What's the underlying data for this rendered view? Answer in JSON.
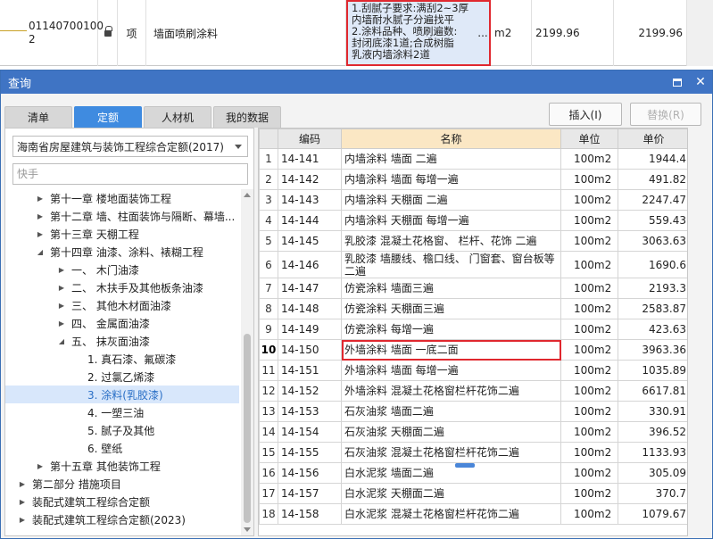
{
  "top_row": {
    "code_line1": "01140700100",
    "code_line2": "2",
    "unit": "项",
    "name": "墙面喷刷涂料",
    "description": "1.刮腻子要求:满刮2~3厚\n内墙耐水腻子分遍找平\n2.涂料品种、喷刷遍数:\n封闭底漆1道;合成树脂\n乳液内墙涂料2道",
    "dots": "...",
    "measure_unit": "m2",
    "price1": "2199.96",
    "price2": "2199.96"
  },
  "dialog": {
    "title": "查询",
    "tabs": [
      {
        "label": "清单"
      },
      {
        "label": "定额"
      },
      {
        "label": "人材机"
      },
      {
        "label": "我的数据"
      }
    ],
    "insert_label": "插入(I)",
    "replace_label": "替换(R)"
  },
  "left": {
    "select_value": "海南省房屋建筑与装饰工程综合定额(2017)",
    "search_placeholder": "快手",
    "tree": [
      {
        "label": "第十一章 楼地面装饰工程",
        "level": 1,
        "toggle": "▶",
        "selected": false
      },
      {
        "label": "第十二章 墙、柱面装饰与隔断、幕墙...",
        "level": 1,
        "toggle": "▶",
        "selected": false
      },
      {
        "label": "第十三章 天棚工程",
        "level": 1,
        "toggle": "▶",
        "selected": false
      },
      {
        "label": "第十四章 油漆、涂料、裱糊工程",
        "level": 1,
        "toggle": "◢",
        "selected": false
      },
      {
        "label": "一、 木门油漆",
        "level": 2,
        "toggle": "▶",
        "selected": false
      },
      {
        "label": "二、 木扶手及其他板条油漆",
        "level": 2,
        "toggle": "▶",
        "selected": false
      },
      {
        "label": "三、 其他木材面油漆",
        "level": 2,
        "toggle": "▶",
        "selected": false
      },
      {
        "label": "四、 金属面油漆",
        "level": 2,
        "toggle": "▶",
        "selected": false
      },
      {
        "label": "五、 抹灰面油漆",
        "level": 2,
        "toggle": "◢",
        "selected": false
      },
      {
        "label": "1. 真石漆、氟碳漆",
        "level": 3,
        "toggle": "",
        "selected": false
      },
      {
        "label": "2. 过氯乙烯漆",
        "level": 3,
        "toggle": "",
        "selected": false
      },
      {
        "label": "3. 涂料(乳胶漆)",
        "level": 3,
        "toggle": "",
        "selected": true
      },
      {
        "label": "4. 一塑三油",
        "level": 3,
        "toggle": "",
        "selected": false
      },
      {
        "label": "5. 腻子及其他",
        "level": 3,
        "toggle": "",
        "selected": false
      },
      {
        "label": "6. 壁纸",
        "level": 3,
        "toggle": "",
        "selected": false
      },
      {
        "label": "第十五章 其他装饰工程",
        "level": 1,
        "toggle": "▶",
        "selected": false
      },
      {
        "label": "第二部分 措施项目",
        "level": 0,
        "toggle": "▶",
        "selected": false
      },
      {
        "label": "装配式建筑工程综合定额",
        "level": 0,
        "toggle": "▶",
        "selected": false
      },
      {
        "label": "装配式建筑工程综合定额(2023)",
        "level": 0,
        "toggle": "▶",
        "selected": false
      }
    ]
  },
  "table": {
    "headers": [
      "",
      "编码",
      "名称",
      "单位",
      "单价"
    ],
    "rows": [
      {
        "idx": "1",
        "code": "14-141",
        "name": "内墙涂料 墙面 二遍",
        "unit": "100m2",
        "price": "1944.4"
      },
      {
        "idx": "2",
        "code": "14-142",
        "name": "内墙涂料 墙面 每增一遍",
        "unit": "100m2",
        "price": "491.82"
      },
      {
        "idx": "3",
        "code": "14-143",
        "name": "内墙涂料 天棚面 二遍",
        "unit": "100m2",
        "price": "2247.47"
      },
      {
        "idx": "4",
        "code": "14-144",
        "name": "内墙涂料 天棚面 每增一遍",
        "unit": "100m2",
        "price": "559.43"
      },
      {
        "idx": "5",
        "code": "14-145",
        "name": "乳胶漆 混凝土花格窗、 栏杆、花饰 二遍",
        "unit": "100m2",
        "price": "3063.63"
      },
      {
        "idx": "6",
        "code": "14-146",
        "name": "乳胶漆 墙腰线、檐口线、 门窗套、窗台板等 二遍",
        "unit": "100m2",
        "price": "1690.6"
      },
      {
        "idx": "7",
        "code": "14-147",
        "name": "仿瓷涂料 墙面三遍",
        "unit": "100m2",
        "price": "2193.3"
      },
      {
        "idx": "8",
        "code": "14-148",
        "name": "仿瓷涂料 天棚面三遍",
        "unit": "100m2",
        "price": "2583.87"
      },
      {
        "idx": "9",
        "code": "14-149",
        "name": "仿瓷涂料 每增一遍",
        "unit": "100m2",
        "price": "423.63"
      },
      {
        "idx": "10",
        "code": "14-150",
        "name": "外墙涂料 墙面 一底二面",
        "unit": "100m2",
        "price": "3963.36"
      },
      {
        "idx": "11",
        "code": "14-151",
        "name": "外墙涂料 墙面 每增一遍",
        "unit": "100m2",
        "price": "1035.89"
      },
      {
        "idx": "12",
        "code": "14-152",
        "name": "外墙涂料 混凝土花格窗栏杆花饰二遍",
        "unit": "100m2",
        "price": "6617.81"
      },
      {
        "idx": "13",
        "code": "14-153",
        "name": "石灰油浆 墙面二遍",
        "unit": "100m2",
        "price": "330.91"
      },
      {
        "idx": "14",
        "code": "14-154",
        "name": "石灰油浆 天棚面二遍",
        "unit": "100m2",
        "price": "396.52"
      },
      {
        "idx": "15",
        "code": "14-155",
        "name": "石灰油浆 混凝土花格窗栏杆花饰二遍",
        "unit": "100m2",
        "price": "1133.93"
      },
      {
        "idx": "16",
        "code": "14-156",
        "name": "白水泥浆 墙面二遍",
        "unit": "100m2",
        "price": "305.09"
      },
      {
        "idx": "17",
        "code": "14-157",
        "name": "白水泥浆 天棚面二遍",
        "unit": "100m2",
        "price": "370.7"
      },
      {
        "idx": "18",
        "code": "14-158",
        "name": "白水泥浆 混凝土花格窗栏杆花饰二遍",
        "unit": "100m2",
        "price": "1079.67"
      }
    ],
    "highlight_idx": "10"
  }
}
